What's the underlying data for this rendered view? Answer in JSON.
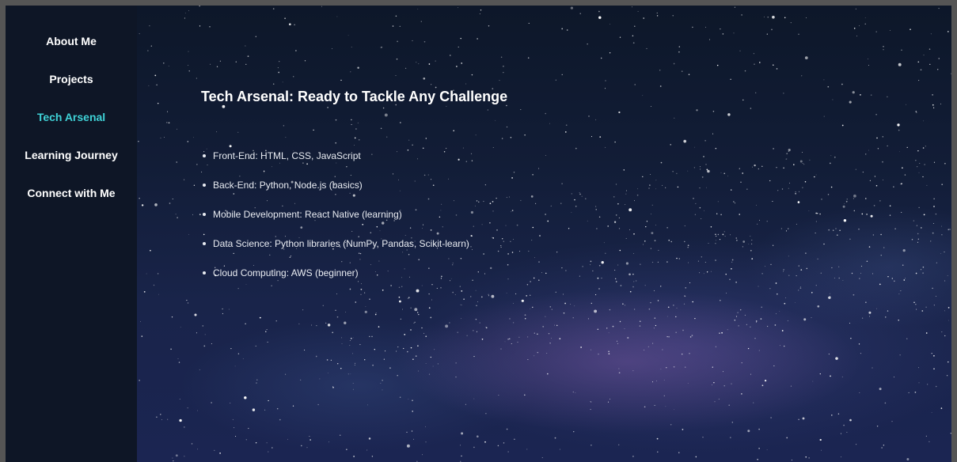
{
  "sidebar": {
    "items": [
      {
        "label": "About Me"
      },
      {
        "label": "Projects"
      },
      {
        "label": "Tech Arsenal",
        "active": true
      },
      {
        "label": "Learning Journey"
      },
      {
        "label": "Connect with Me"
      }
    ]
  },
  "main": {
    "title": "Tech Arsenal: Ready to Tackle Any Challenge",
    "skills": [
      "Front-End: HTML, CSS, JavaScript",
      "Back-End: Python, Node.js (basics)",
      "Mobile Development: React Native (learning)",
      "Data Science: Python libraries (NumPy, Pandas, Scikit-learn)",
      "Cloud Computing: AWS (beginner)"
    ]
  },
  "colors": {
    "sidebar_bg": "#0e1626",
    "active_nav": "#3fd1d6",
    "text": "#ffffff",
    "window_border": "#555555"
  },
  "background": "starry-night-sky"
}
